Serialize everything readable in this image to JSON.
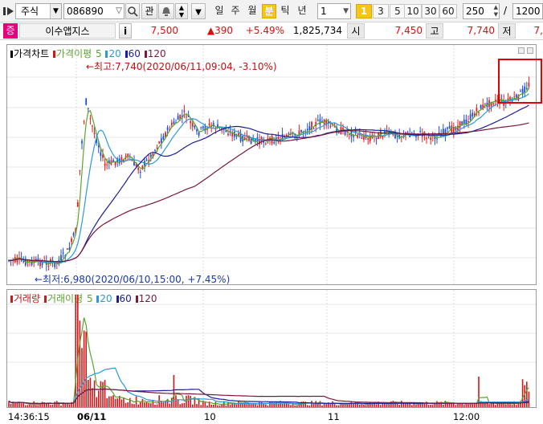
{
  "toolbar": {
    "market": "주식",
    "code": "086890",
    "fav_label": "관",
    "periods": [
      "일",
      "주",
      "월",
      "분",
      "틱",
      "년"
    ],
    "active_period": "분",
    "interval_value": "1",
    "minute_buttons": [
      "1",
      "3",
      "5",
      "10",
      "30",
      "60"
    ],
    "active_minute": "1",
    "count_value": "250",
    "count_separator": "/",
    "count_total": "1200"
  },
  "infobar": {
    "badge": "증",
    "name": "이수앱지스",
    "info_btn": "i",
    "price": "7,500",
    "change": "▲390",
    "change_pct": "+5.49%",
    "volume": "1,825,734",
    "open_label": "시",
    "open": "7,450",
    "high_label": "고",
    "high": "7,740",
    "low_label": "저",
    "low": "7,"
  },
  "price_panel": {
    "title": "가격차트",
    "ma_label": "가격이평",
    "ma_periods": [
      "5",
      "20",
      "60",
      "120"
    ],
    "high_annot": "←최고:7,740(2020/06/11,09:04, -3.10%)",
    "low_annot": "←최저:6,980(2020/06/10,15:00, +7.45%)"
  },
  "volume_panel": {
    "title": "거래량",
    "ma_label": "거래이평",
    "ma_periods": [
      "5",
      "20",
      "60",
      "120"
    ]
  },
  "x_axis": {
    "labels": [
      "14:36:15",
      "06/11",
      "10",
      "11",
      "12:00"
    ]
  },
  "colors": {
    "up": "#e02020",
    "down": "#1a4fd8",
    "ma5": "#5aa52c",
    "ma20": "#2b9ad6",
    "ma60": "#1c1c9c",
    "ma120": "#7a1a3a",
    "volume": "#d01818",
    "highlight": "#e00000"
  }
}
